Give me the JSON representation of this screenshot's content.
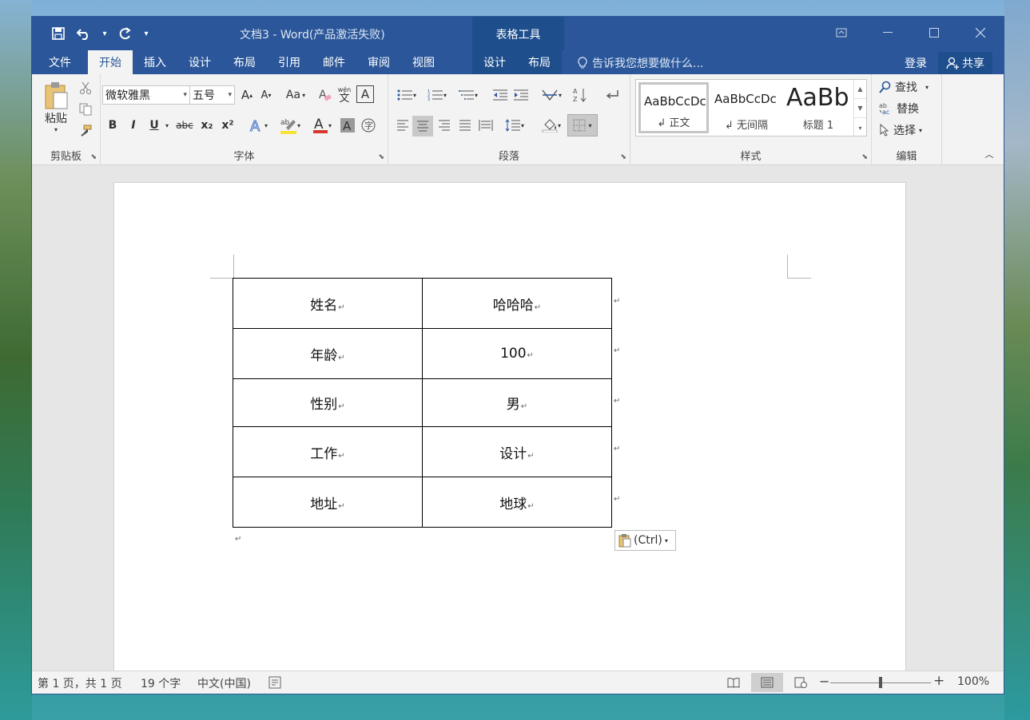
{
  "window": {
    "title": "文档3 - Word(产品激活失败)",
    "context_group": "表格工具"
  },
  "qat": {
    "save": "save-icon",
    "undo": "undo-icon",
    "redo": "redo-icon",
    "more": "▾"
  },
  "tabs": [
    "文件",
    "开始",
    "插入",
    "设计",
    "布局",
    "引用",
    "邮件",
    "审阅",
    "视图"
  ],
  "context_tabs": [
    "设计",
    "布局"
  ],
  "tellme": "告诉我您想要做什么...",
  "signin": "登录",
  "share": "共享",
  "ribbon": {
    "clipboard": {
      "label": "剪贴板",
      "paste": "粘贴"
    },
    "font": {
      "label": "字体",
      "font_name": "微软雅黑",
      "font_size": "五号",
      "grow": "A",
      "shrink": "A",
      "case": "Aa",
      "bold": "B",
      "italic": "I",
      "underline": "U",
      "strike": "abc",
      "sub": "x₂",
      "sup": "x²",
      "color_a": "A",
      "phonetic": "wén",
      "phonetic_char": "文"
    },
    "paragraph": {
      "label": "段落"
    },
    "styles": {
      "label": "样式",
      "items": [
        {
          "sample": "AaBbCcDc",
          "name": "↲ 正文"
        },
        {
          "sample": "AaBbCcDc",
          "name": "↲ 无间隔"
        },
        {
          "sample": "AaBb",
          "name": "标题 1"
        }
      ]
    },
    "editing": {
      "label": "编辑",
      "find": "查找",
      "replace": "替换",
      "select": "选择"
    }
  },
  "table": [
    {
      "key": "姓名",
      "value": "哈哈哈"
    },
    {
      "key": "年龄",
      "value": "100"
    },
    {
      "key": "性别",
      "value": "男"
    },
    {
      "key": "工作",
      "value": "设计"
    },
    {
      "key": "地址",
      "value": "地球"
    }
  ],
  "paste_options": "(Ctrl)",
  "status": {
    "page": "第 1 页，共 1 页",
    "words": "19 个字",
    "language": "中文(中国)",
    "zoom": "100%",
    "zoom_value": 100
  },
  "colors": {
    "accent": "#2b579a",
    "context": "#1e4e8c"
  }
}
